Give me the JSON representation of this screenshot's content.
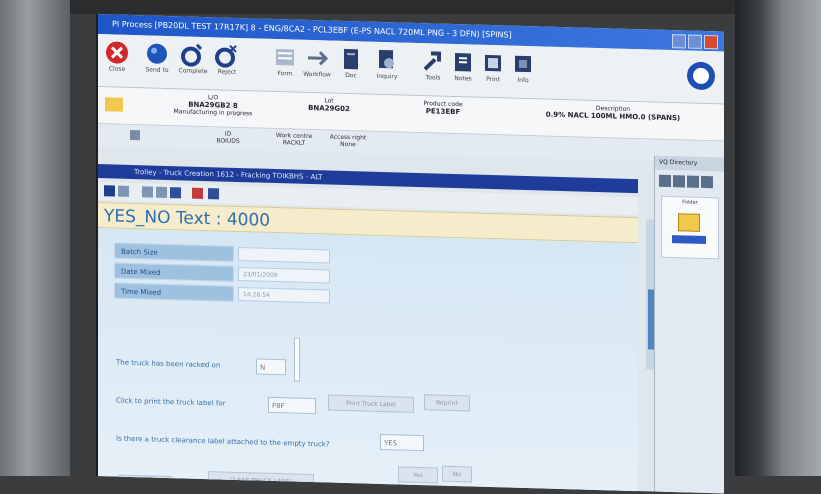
{
  "window": {
    "title": "PI Process [PB20DL TEST 17R17K] 8 - ENG/8CA2 - PCL3EBF (E-PS NACL 720ML PNG - 3 DFN) [SPINS]"
  },
  "toolbar": {
    "items": [
      {
        "label": "Close",
        "icon": "close-icon"
      },
      {
        "label": "Send to",
        "icon": "globe-icon"
      },
      {
        "label": "Complete",
        "icon": "checklist-icon"
      },
      {
        "label": "Reject",
        "icon": "checklist-x-icon"
      },
      {
        "label": "Form",
        "icon": "form-icon"
      },
      {
        "label": "Workflow",
        "icon": "workflow-icon"
      },
      {
        "label": "Doc",
        "icon": "document-icon"
      },
      {
        "label": "Inquiry",
        "icon": "search-doc-icon"
      },
      {
        "label": "Tools",
        "icon": "tools-icon"
      },
      {
        "label": "Notes",
        "icon": "notes-icon"
      },
      {
        "label": "Print",
        "icon": "print-icon"
      },
      {
        "label": "Info",
        "icon": "info-icon"
      }
    ],
    "logo": "company-logo-icon"
  },
  "info": {
    "order_label": "L/O",
    "order_value": "BNA29GB2 8",
    "order_status": "Manufacturing in progress",
    "lot_label": "Lot",
    "lot_value": "BNA29G02",
    "product_label": "Product code",
    "product_value": "PE13EBF",
    "desc_label": "Description",
    "desc_value": "0.9% NACL 100ML HMO.0 (SPANS)"
  },
  "subrow": {
    "id_label": "ID",
    "id_value": "BOIUDS",
    "status_label": "Work centre",
    "status_value": "RACKLT",
    "access_label": "Access right",
    "access_value": "None"
  },
  "section": {
    "title": "Trolley - Truck Creation 1612 - Fracking TOIKBHS - ALT"
  },
  "banner": {
    "text": "YES_NO Text : 4000"
  },
  "form": {
    "rows": [
      {
        "label": "Batch Size",
        "value": ""
      },
      {
        "label": "Date Mixed",
        "value": "23/01/2009"
      },
      {
        "label": "Time Mixed",
        "value": "14:26:54"
      }
    ],
    "q1": "The truck has been racked on",
    "q1_value": "N",
    "q2": "Click to print the truck label for",
    "q2_value": "P8F",
    "q2_button": "Print Truck Label",
    "q2_extra": "Reprint",
    "q3": "Is there a truck clearance label attached to the empty truck?",
    "q3_value": "YES",
    "q4": "Comments",
    "q4_button": "CLEAR TRUCK LABEL",
    "q4_field": "Yes",
    "q4_field2": "No"
  },
  "right_panel": {
    "title": "VQ Directory",
    "box_title": "Folder",
    "colors": {
      "selected": "#2f59c4"
    }
  },
  "colors": {
    "titlebar": "#1f57c8",
    "section_bar": "#1f3c9b",
    "banner_bg": "#f5eccb",
    "banner_text": "#2f6fb0",
    "label_bg": "#9fc1e0"
  }
}
